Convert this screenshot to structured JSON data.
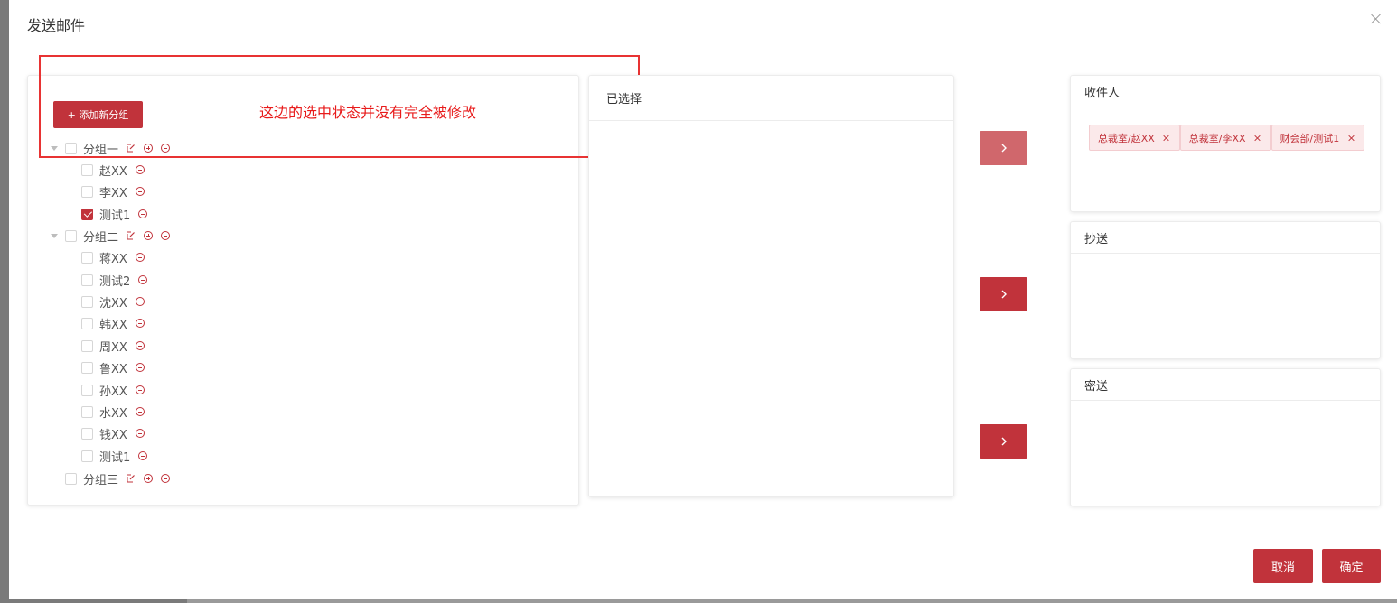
{
  "dialog": {
    "title": "发送邮件",
    "close_icon": "close-icon"
  },
  "tree_panel": {
    "add_group_label": "+ 添加新分组",
    "groups": [
      {
        "label": "分组一",
        "expanded": true,
        "checked": false,
        "members": [
          {
            "label": "赵XX",
            "checked": false
          },
          {
            "label": "李XX",
            "checked": false
          },
          {
            "label": "测试1",
            "checked": true
          }
        ]
      },
      {
        "label": "分组二",
        "expanded": true,
        "checked": false,
        "members": [
          {
            "label": "蒋XX",
            "checked": false
          },
          {
            "label": "测试2",
            "checked": false
          },
          {
            "label": "沈XX",
            "checked": false
          },
          {
            "label": "韩XX",
            "checked": false
          },
          {
            "label": "周XX",
            "checked": false
          },
          {
            "label": "鲁XX",
            "checked": false
          },
          {
            "label": "孙XX",
            "checked": false
          },
          {
            "label": "水XX",
            "checked": false
          },
          {
            "label": "钱XX",
            "checked": false
          },
          {
            "label": "测试1",
            "checked": false
          }
        ]
      },
      {
        "label": "分组三",
        "expanded": false,
        "checked": false,
        "members": []
      }
    ],
    "annotation": "这边的选中状态并没有完全被修改"
  },
  "selected_panel": {
    "title": "已选择"
  },
  "arrows": {
    "to_recipient": ">",
    "to_cc": ">",
    "to_bcc": ">"
  },
  "recipients": {
    "to": {
      "title": "收件人",
      "tags": [
        "总裁室/赵XX",
        "总裁室/李XX",
        "财会部/测试1"
      ]
    },
    "cc": {
      "title": "抄送",
      "tags": []
    },
    "bcc": {
      "title": "密送",
      "tags": []
    }
  },
  "footer": {
    "cancel_label": "取消",
    "confirm_label": "确定"
  },
  "colors": {
    "accent": "#c1333b",
    "annotation": "#e83333"
  }
}
